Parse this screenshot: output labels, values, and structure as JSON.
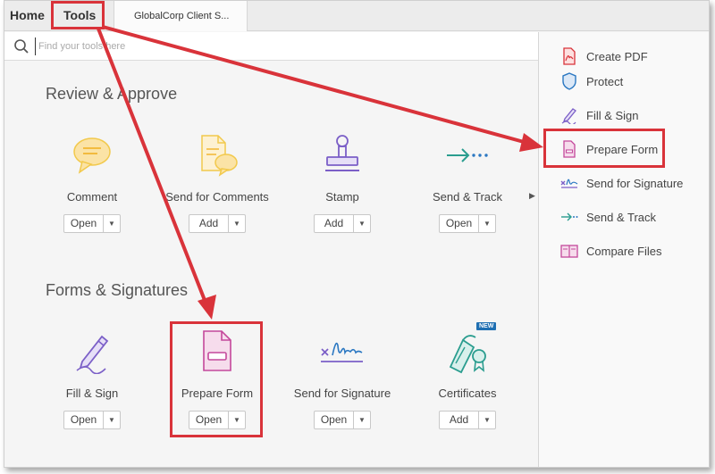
{
  "tabs": {
    "home": "Home",
    "tools": "Tools",
    "document": "GlobalCorp Client S..."
  },
  "search": {
    "placeholder": "Find your tools here"
  },
  "sections": {
    "review": {
      "title": "Review & Approve",
      "tools": [
        {
          "name": "Comment",
          "action": "Open"
        },
        {
          "name": "Send for Comments",
          "action": "Add"
        },
        {
          "name": "Stamp",
          "action": "Add"
        },
        {
          "name": "Send & Track",
          "action": "Open"
        }
      ]
    },
    "forms": {
      "title": "Forms & Signatures",
      "tools": [
        {
          "name": "Fill & Sign",
          "action": "Open"
        },
        {
          "name": "Prepare Form",
          "action": "Open"
        },
        {
          "name": "Send for Signature",
          "action": "Open"
        },
        {
          "name": "Certificates",
          "action": "Add",
          "badge": "NEW"
        }
      ]
    }
  },
  "right_pane": {
    "items": [
      {
        "label": "Create PDF"
      },
      {
        "label": "Protect"
      },
      {
        "label": "Fill & Sign"
      },
      {
        "label": "Prepare Form"
      },
      {
        "label": "Send for Signature"
      },
      {
        "label": "Send & Track"
      },
      {
        "label": "Compare Files"
      }
    ]
  },
  "colors": {
    "annotation": "#d9333a",
    "comment_yellow": "#f2c94c",
    "purple": "#7b5fc7",
    "teal": "#2a9d8f",
    "blue": "#2b78c2",
    "pink": "#c4489b"
  }
}
